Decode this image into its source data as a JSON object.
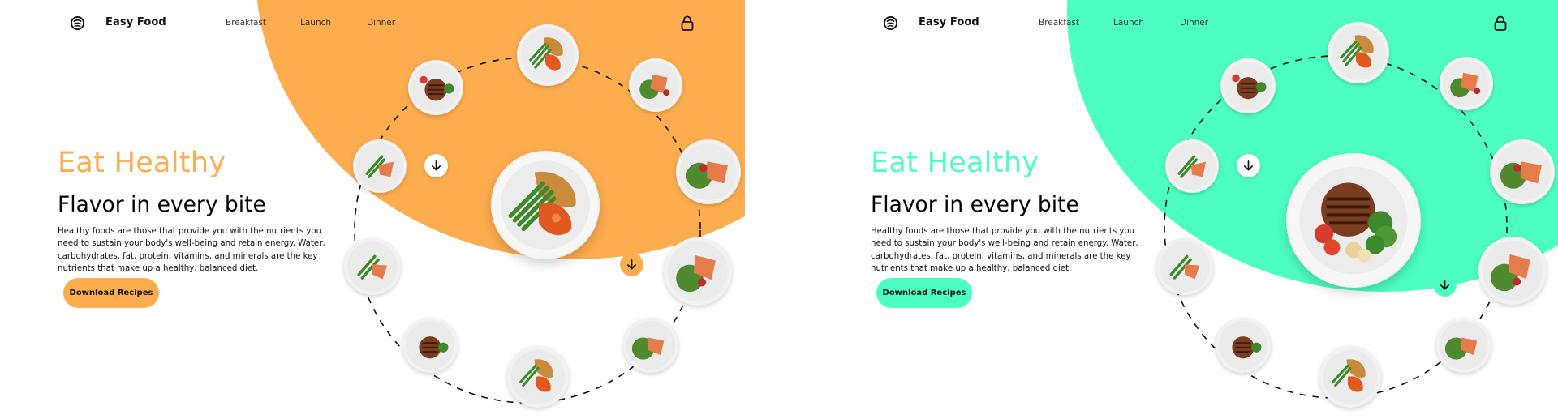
{
  "colors": {
    "orange": "#FEAD4E",
    "mint": "#4CFFC1",
    "text": "#111111",
    "white": "#FFFFFF"
  },
  "panels": [
    {
      "accent": "#FEAD4E",
      "brand": "Easy Food",
      "nav": [
        "Breakfast",
        "Launch",
        "Dinner"
      ],
      "hero": {
        "title": "Eat Healthy",
        "subtitle": "Flavor in every bite",
        "description": "Healthy foods are those that provide you with the nutrients you need to sustain your body's well-being and retain energy. Water, carbohydrates, fat, protein, vitamins, and minerals are the key nutrients that make up a healthy, balanced diet."
      },
      "cta_label": "Download Recipes",
      "featured_dish": "chicken-beans-rice-dish",
      "icons": {
        "logo": "food-bowl-icon",
        "bag": "lock-bag-icon",
        "arrow": "arrow-down-icon"
      }
    },
    {
      "accent": "#4CFFC1",
      "brand": "Easy Food",
      "nav": [
        "Breakfast",
        "Launch",
        "Dinner"
      ],
      "hero": {
        "title": "Eat Healthy",
        "subtitle": "Flavor in every bite",
        "description": "Healthy foods are those that provide you with the nutrients you need to sustain your body's well-being and retain energy. Water, carbohydrates, fat, protein, vitamins, and minerals are the key nutrients that make up a healthy, balanced diet."
      },
      "cta_label": "Download Recipes",
      "featured_dish": "steak-broccoli-tomato-dish",
      "icons": {
        "logo": "food-bowl-icon",
        "bag": "lock-bag-icon",
        "arrow": "arrow-down-icon"
      }
    }
  ]
}
